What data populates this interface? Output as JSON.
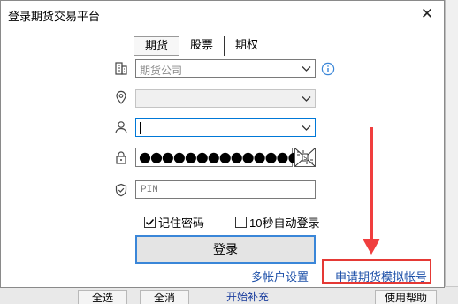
{
  "dialog": {
    "title": "登录期货交易平台",
    "close_label": "✕"
  },
  "tabs": [
    "期货",
    "股票",
    "期权"
  ],
  "form": {
    "broker_value": "期货公司",
    "server_value": "",
    "account_value": "",
    "password_mask": "●●●●●●●●●●●●●●",
    "pin_placeholder": "PIN",
    "remember_label": "记住密码",
    "remember_checked": true,
    "auto_login_label": "10秒自动登录",
    "auto_login_checked": false,
    "login_label": "登录",
    "multi_account_label": "多帐户设置",
    "apply_sim_label": "申请期货模拟帐号"
  },
  "background": {
    "buttons": [
      "全选",
      "全消",
      "开始补充",
      "使用帮助"
    ]
  },
  "colors": {
    "accent": "#3a86d8",
    "link": "#1c4fa8",
    "annotation": "#e53935"
  }
}
